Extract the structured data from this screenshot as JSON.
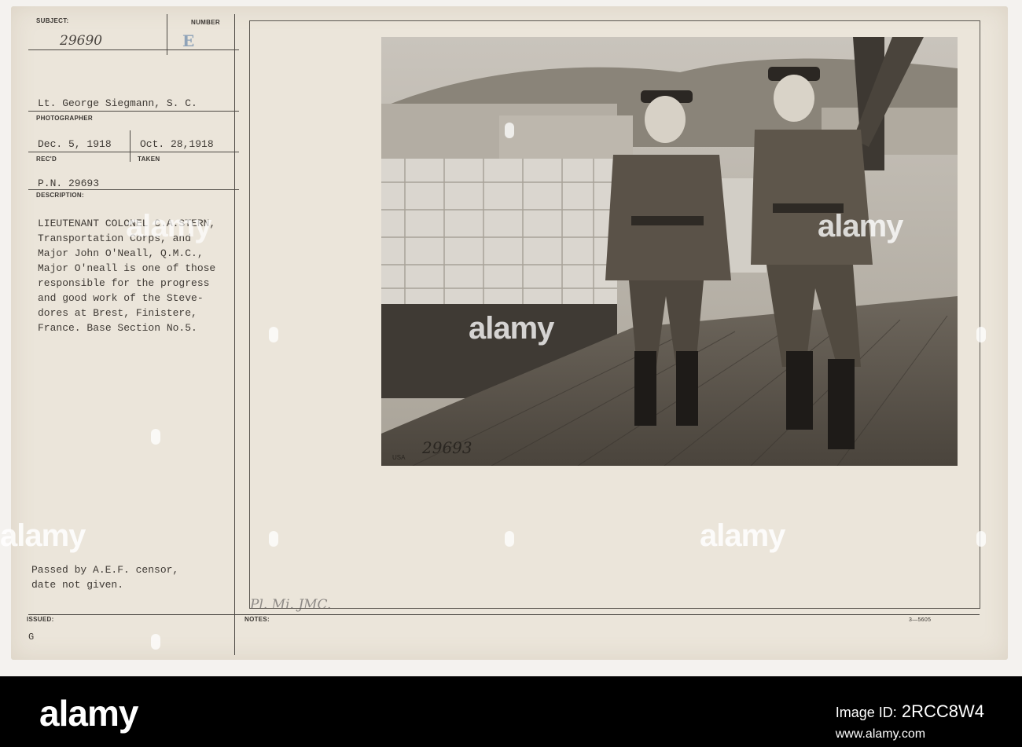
{
  "labels": {
    "subject": "SUBJECT:",
    "number": "NUMBER",
    "photographer": "PHOTOGRAPHER",
    "recd": "REC'D",
    "taken": "TAKEN",
    "description": "DESCRIPTION:",
    "issued": "ISSUED:",
    "notes": "NOTES:"
  },
  "record": {
    "subject_number": "29690",
    "number_stamp": "E",
    "photographer": "Lt. George Siegmann, S. C.",
    "received": "Dec. 5, 1918",
    "taken": "Oct. 28,1918",
    "pn": "P.N. 29693",
    "description_lines": [
      "LIEUTENANT COLONEL C.A.STERN,",
      "Transportation Corps, and",
      "Major John O'Neall, Q.M.C.,",
      "Major O'neall is one of those",
      "responsible for the progress",
      "and good work of the Steve-",
      "dores at Brest, Finistere,",
      "France. Base Section No.5."
    ],
    "censor_lines": [
      "Passed by A.E.F. censor,",
      "date not given."
    ],
    "issued": "G",
    "notes_handwritten": "Pl. Mi. JMC.",
    "form_code": "3—5605",
    "photo_negative": "29693",
    "photo_mark": "USA"
  },
  "watermarks": {
    "logo": "alamy"
  },
  "footer": {
    "logo": "alamy",
    "image_id_label": "Image ID:",
    "image_id": "2RCC8W4",
    "site": "www.alamy.com"
  },
  "colors": {
    "card": "#ebe5da",
    "ink": "#3f3a35",
    "footer": "#000000"
  }
}
